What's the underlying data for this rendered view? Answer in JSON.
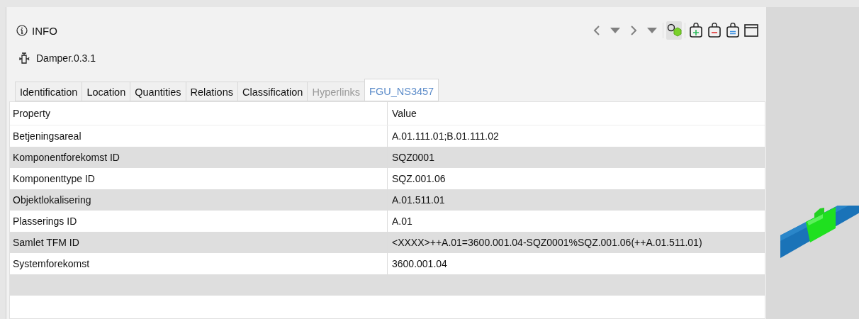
{
  "panel": {
    "title": "INFO",
    "object": "Damper.0.3.1"
  },
  "toolbar": [
    {
      "kind": "back",
      "selected": false
    },
    {
      "kind": "dropdown",
      "selected": false
    },
    {
      "kind": "forward",
      "selected": false
    },
    {
      "kind": "dropdown",
      "selected": false
    },
    {
      "kind": "objects",
      "selected": true
    },
    {
      "kind": "add",
      "selected": false
    },
    {
      "kind": "remove",
      "selected": false
    },
    {
      "kind": "equal",
      "selected": false
    },
    {
      "kind": "window",
      "selected": false
    }
  ],
  "tabs": [
    {
      "label": "Identification",
      "selected": false,
      "disabled": false
    },
    {
      "label": "Location",
      "selected": false,
      "disabled": false
    },
    {
      "label": "Quantities",
      "selected": false,
      "disabled": false
    },
    {
      "label": "Relations",
      "selected": false,
      "disabled": false
    },
    {
      "label": "Classification",
      "selected": false,
      "disabled": false
    },
    {
      "label": "Hyperlinks",
      "selected": false,
      "disabled": true
    },
    {
      "label": "FGU_NS3457",
      "selected": true,
      "disabled": false
    }
  ],
  "table": {
    "columns": [
      "Property",
      "Value"
    ],
    "rows": [
      [
        "Betjeningsareal",
        "A.01.111.01;B.01.111.02"
      ],
      [
        "Komponentforekomst ID",
        "SQZ0001"
      ],
      [
        "Komponenttype ID",
        "SQZ.001.06"
      ],
      [
        "Objektlokalisering",
        "A.01.511.01"
      ],
      [
        "Plasserings ID",
        "A.01"
      ],
      [
        "Samlet TFM ID",
        "<XXXX>++A.01=3600.001.04-SQZ0001%SQZ.001.06(++A.01.511.01)"
      ],
      [
        "Systemforekomst",
        "3600.001.04"
      ]
    ]
  }
}
